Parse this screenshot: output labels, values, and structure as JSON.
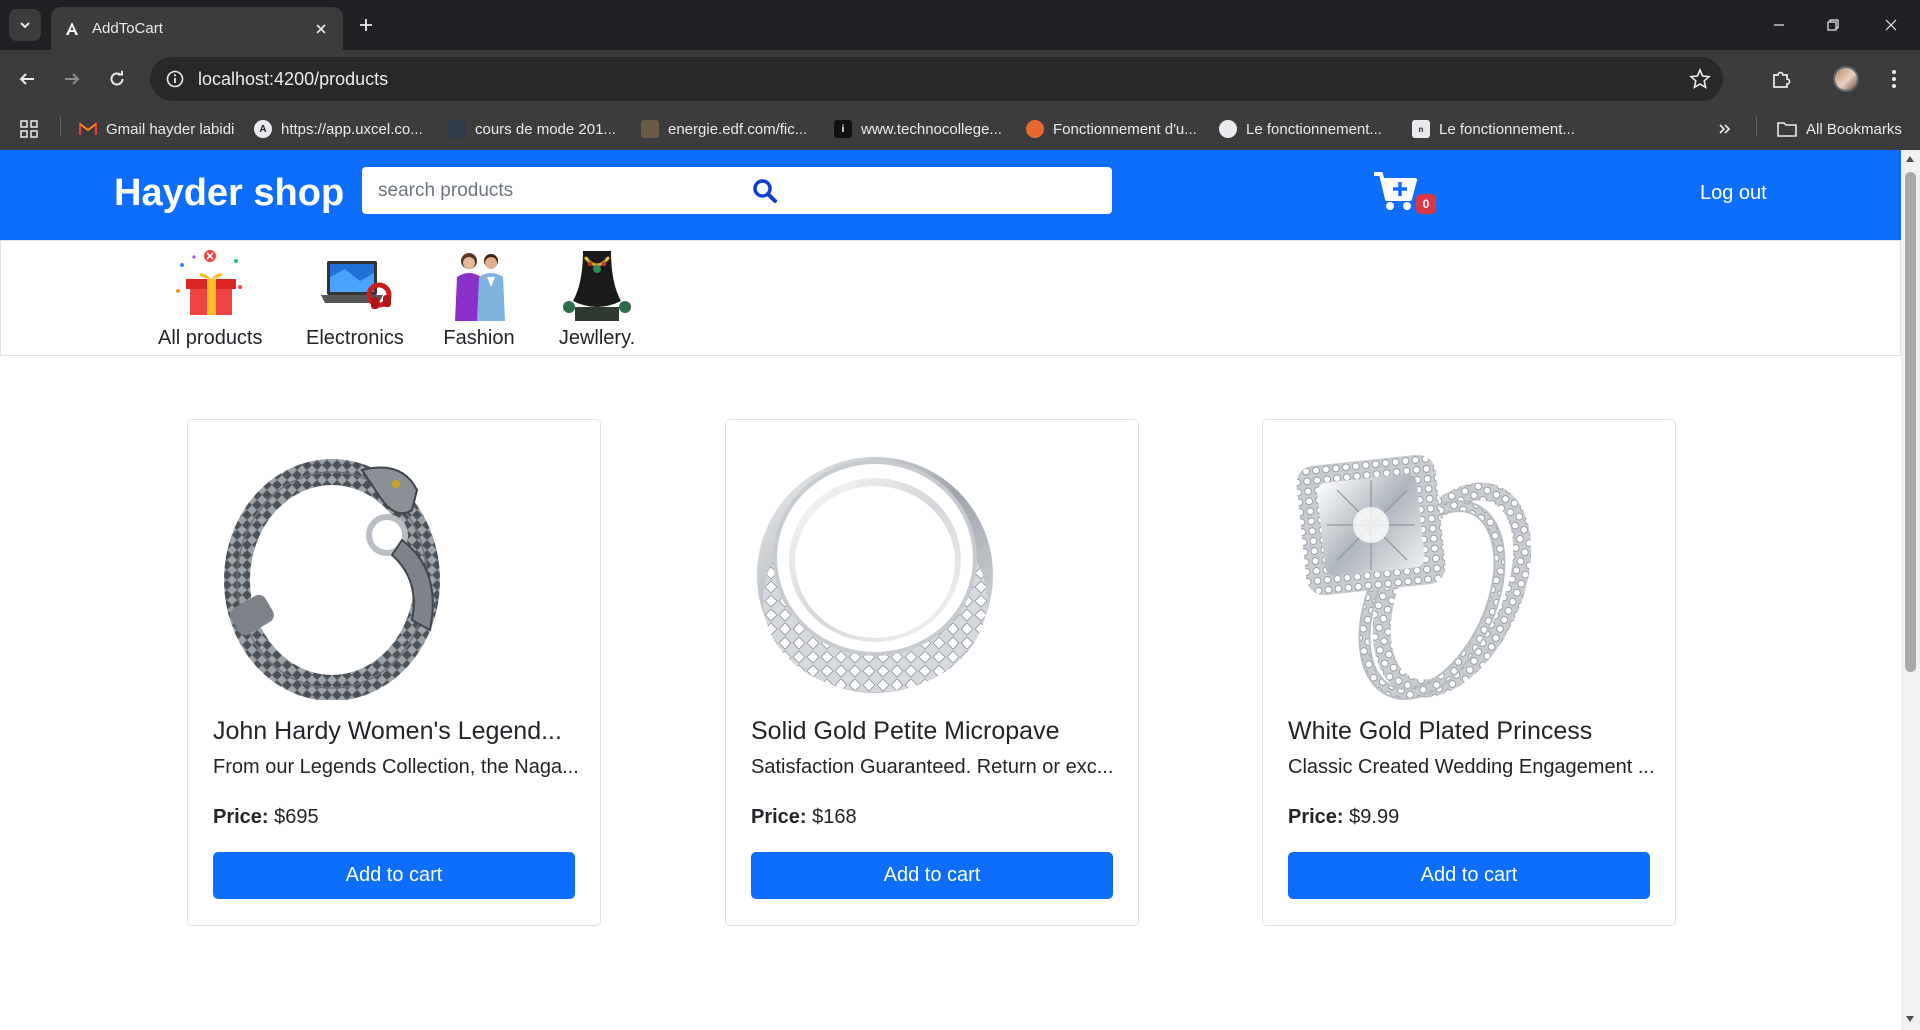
{
  "browser": {
    "tab_title": "AddToCart",
    "url": "localhost:4200/products",
    "bookmarks": [
      {
        "label": "Gmail hayder labidi",
        "icon": "gmail-icon"
      },
      {
        "label": "https://app.uxcel.co...",
        "icon": "uxcel-icon"
      },
      {
        "label": "cours de mode 201...",
        "icon": "site-icon"
      },
      {
        "label": "energie.edf.com/fic...",
        "icon": "edf-icon"
      },
      {
        "label": "www.technocollege...",
        "icon": "technocollege-icon"
      },
      {
        "label": "Fonctionnement d'u...",
        "icon": "site-icon"
      },
      {
        "label": "Le fonctionnement...",
        "icon": "site-icon"
      },
      {
        "label": "Le fonctionnement...",
        "icon": "site-icon"
      }
    ],
    "all_bookmarks_label": "All Bookmarks"
  },
  "header": {
    "brand": "Hayder shop",
    "search_placeholder": "search products",
    "cart_count": "0",
    "logout_label": "Log out",
    "accent_color": "#0d6efd"
  },
  "categories": [
    {
      "label": "All products",
      "icon": "gift-icon"
    },
    {
      "label": "Electronics",
      "icon": "laptop-icon"
    },
    {
      "label": "Fashion",
      "icon": "fashion-icon"
    },
    {
      "label": "Jewllery.",
      "icon": "necklace-icon"
    }
  ],
  "products": [
    {
      "title": "John Hardy Women's Legend...",
      "description": "From our Legends Collection, the Naga...",
      "price_label": "Price:",
      "price": "$695",
      "button": "Add to cart",
      "image": "bracelet-image"
    },
    {
      "title": "Solid Gold Petite Micropave",
      "description": "Satisfaction Guaranteed. Return or exc...",
      "price_label": "Price:",
      "price": "$168",
      "button": "Add to cart",
      "image": "ring-image"
    },
    {
      "title": "White Gold Plated Princess",
      "description": "Classic Created Wedding Engagement ...",
      "price_label": "Price:",
      "price": "$9.99",
      "button": "Add to cart",
      "image": "engagement-ring-image"
    }
  ]
}
